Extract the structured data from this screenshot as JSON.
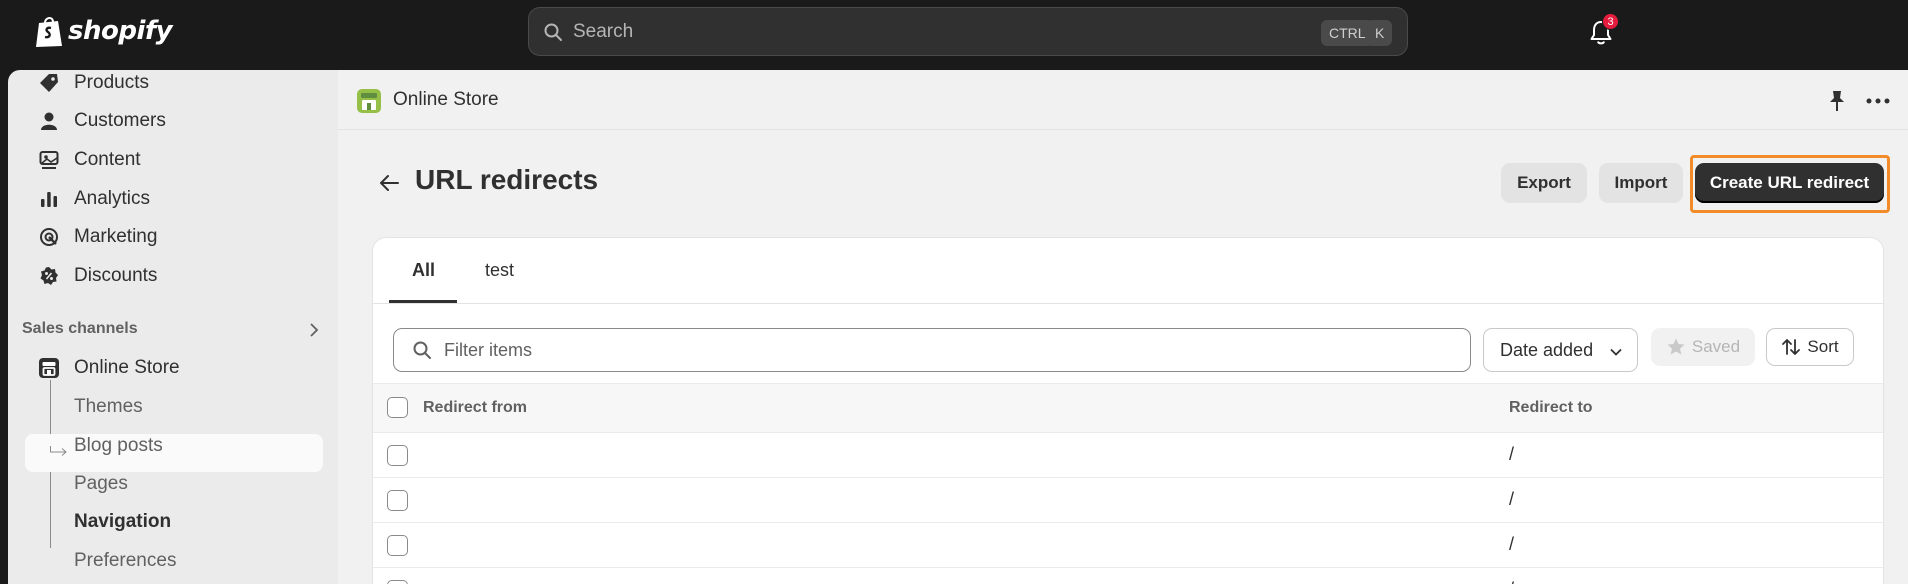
{
  "topbar": {
    "brand": "shopify",
    "search_placeholder": "Search",
    "shortcut_ctrl": "CTRL",
    "shortcut_k": "K",
    "notification_count": "3"
  },
  "sidebar": {
    "items": [
      {
        "label": "Products",
        "icon": "tag-icon"
      },
      {
        "label": "Customers",
        "icon": "person-icon"
      },
      {
        "label": "Content",
        "icon": "content-icon"
      },
      {
        "label": "Analytics",
        "icon": "bar-chart-icon"
      },
      {
        "label": "Marketing",
        "icon": "target-icon"
      },
      {
        "label": "Discounts",
        "icon": "discount-icon"
      }
    ],
    "section_label": "Sales channels",
    "channel": "Online Store",
    "sub_items": [
      "Themes",
      "Blog posts",
      "Pages",
      "Navigation",
      "Preferences"
    ],
    "active_sub_item": "Navigation"
  },
  "breadcrumb": {
    "label": "Online Store"
  },
  "page": {
    "title": "URL redirects",
    "export_label": "Export",
    "import_label": "Import",
    "create_label": "Create URL redirect"
  },
  "tabs": [
    {
      "label": "All"
    },
    {
      "label": "test"
    }
  ],
  "filter": {
    "placeholder": "Filter items",
    "date_label": "Date added",
    "saved_label": "Saved",
    "sort_label": "Sort"
  },
  "table": {
    "columns": [
      "Redirect from",
      "Redirect to"
    ],
    "rows": [
      {
        "from": "",
        "to": "/"
      },
      {
        "from": "",
        "to": "/"
      },
      {
        "from": "",
        "to": "/"
      },
      {
        "from": "",
        "to": "/"
      }
    ]
  },
  "colors": {
    "topbar": "#1a1a1a",
    "primary_button": "#303030",
    "highlight": "#f28c28",
    "badge": "#e51c3e"
  }
}
